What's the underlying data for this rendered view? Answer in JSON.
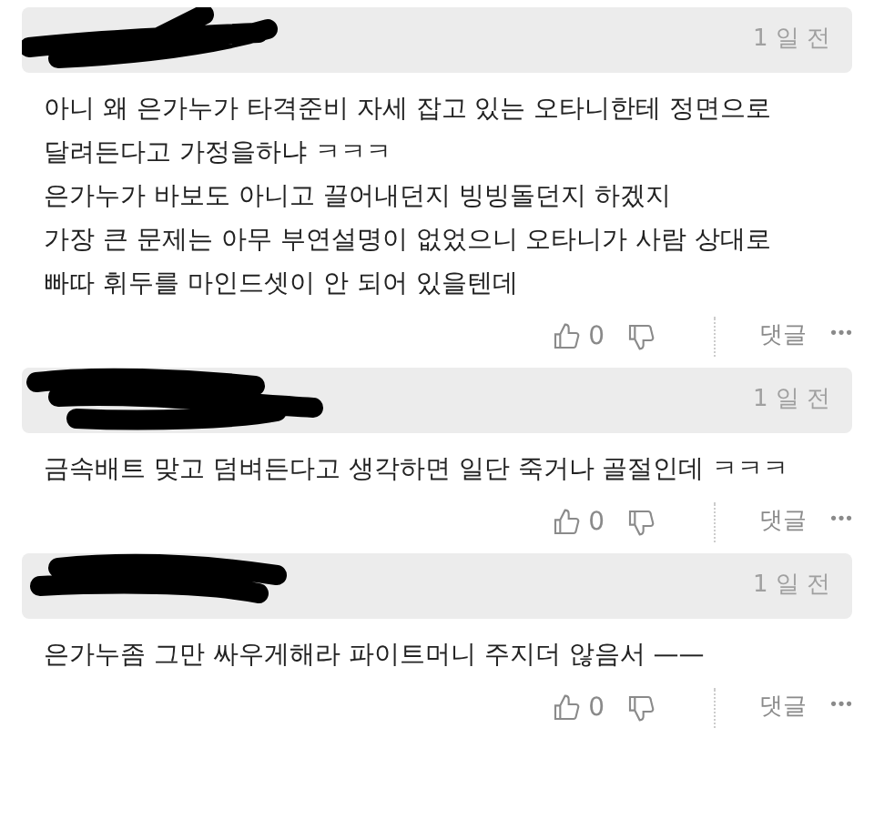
{
  "comments": [
    {
      "time": "1 일 전",
      "text": [
        "아니 왜 은가누가 타격준비 자세 잡고 있는 오타니한테 정면으로",
        "달려든다고 가정을하냐 ㅋㅋㅋ",
        "은가누가 바보도 아니고 끌어내던지 빙빙돌던지 하겠지",
        "가장 큰 문제는 아무 부연설명이 없었으니 오타니가 사람 상대로",
        "빠따 휘두를 마인드셋이 안 되어 있을텐데"
      ],
      "likes": "0",
      "reply": "댓글",
      "more": "•••"
    },
    {
      "time": "1 일 전",
      "text": [
        "금속배트 맞고 덤벼든다고 생각하면 일단 죽거나 골절인데 ㅋㅋㅋ"
      ],
      "likes": "0",
      "reply": "댓글",
      "more": "•••"
    },
    {
      "time": "1 일 전",
      "text": [
        "은가누좀 그만 싸우게해라 파이트머니 주지더 않음서 ——"
      ],
      "likes": "0",
      "reply": "댓글",
      "more": "•••"
    }
  ]
}
